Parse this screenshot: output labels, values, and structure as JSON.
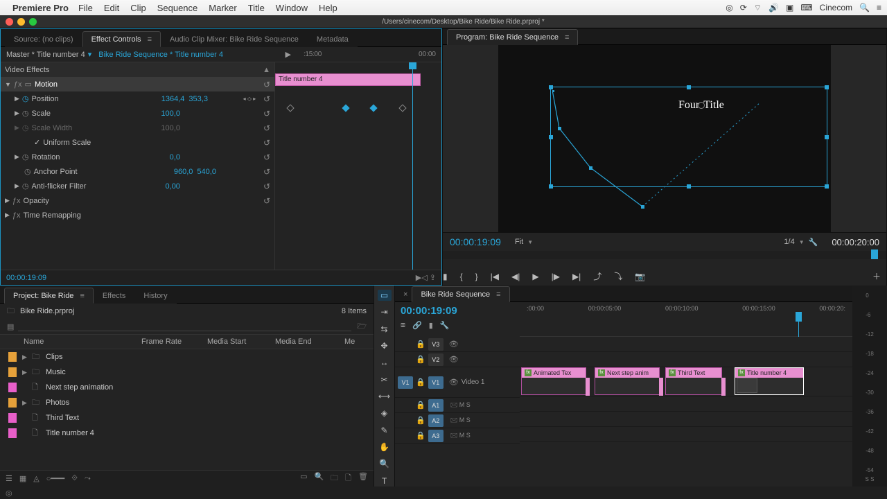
{
  "menubar": {
    "app": "Premiere Pro",
    "items": [
      "File",
      "Edit",
      "Clip",
      "Sequence",
      "Marker",
      "Title",
      "Window",
      "Help"
    ],
    "right_user": "Cinecom"
  },
  "doc_path": "/Users/cinecom/Desktop/Bike Ride/Bike Ride.prproj *",
  "source_tab": "Source: (no clips)",
  "ec_tab": "Effect Controls",
  "mixer_tab": "Audio Clip Mixer: Bike Ride Sequence",
  "meta_tab": "Metadata",
  "ec": {
    "master": "Master * Title number 4",
    "sequence_link": "Bike Ride Sequence * Title number 4",
    "ruler_a": ":15:00",
    "ruler_b": "00:00",
    "section_video": "Video Effects",
    "clip_label": "Title number 4",
    "motion": "Motion",
    "position": "Position",
    "pos_x": "1364,4",
    "pos_y": "353,3",
    "scale": "Scale",
    "scale_v": "100,0",
    "scale_w": "Scale Width",
    "scale_w_v": "100,0",
    "uniform": "Uniform Scale",
    "rotation": "Rotation",
    "rotation_v": "0,0",
    "anchor": "Anchor Point",
    "anchor_x": "960,0",
    "anchor_y": "540,0",
    "flicker": "Anti-flicker Filter",
    "flicker_v": "0,00",
    "opacity": "Opacity",
    "remap": "Time Remapping",
    "tc": "00:00:19:09"
  },
  "program": {
    "tab": "Program: Bike Ride Sequence",
    "title_text": "Fourth Title",
    "tc": "00:00:19:09",
    "fit": "Fit",
    "quality": "1/4",
    "duration": "00:00:20:00"
  },
  "project": {
    "tab": "Project: Bike Ride",
    "tab_effects": "Effects",
    "tab_history": "History",
    "file": "Bike Ride.prproj",
    "count": "8 Items",
    "cols": [
      "Name",
      "Frame Rate",
      "Media Start",
      "Media End",
      "Me"
    ],
    "items": [
      {
        "color": "#e6a13a",
        "tw": "▶",
        "icon": "folder",
        "name": "Clips"
      },
      {
        "color": "#e6a13a",
        "tw": "▶",
        "icon": "folder",
        "name": "Music"
      },
      {
        "color": "#e85fc9",
        "tw": "",
        "icon": "title",
        "name": "Next step animation"
      },
      {
        "color": "#e6a13a",
        "tw": "▶",
        "icon": "folder",
        "name": "Photos"
      },
      {
        "color": "#e85fc9",
        "tw": "",
        "icon": "title",
        "name": "Third Text"
      },
      {
        "color": "#e85fc9",
        "tw": "",
        "icon": "title",
        "name": "Title number 4"
      }
    ]
  },
  "timeline": {
    "tab": "Bike Ride Sequence",
    "tc": "00:00:19:09",
    "ticks": [
      ":00:00",
      "00:00:05:00",
      "00:00:10:00",
      "00:00:15:00",
      "00:00:20:"
    ],
    "tracks": {
      "v3": "V3",
      "v2": "V2",
      "v1": "V1",
      "v1_name": "Video 1",
      "a1": "A1",
      "a2": "A2",
      "a3": "A3"
    },
    "clips": [
      {
        "label": "Animated Tex"
      },
      {
        "label": "Next step anim"
      },
      {
        "label": "Third Text"
      },
      {
        "label": "Title number 4"
      }
    ]
  },
  "meter_ticks": [
    "0",
    "-6",
    "-12",
    "-18",
    "-24",
    "-30",
    "-36",
    "-42",
    "-48",
    "-54"
  ],
  "meter_foot": "S  S"
}
